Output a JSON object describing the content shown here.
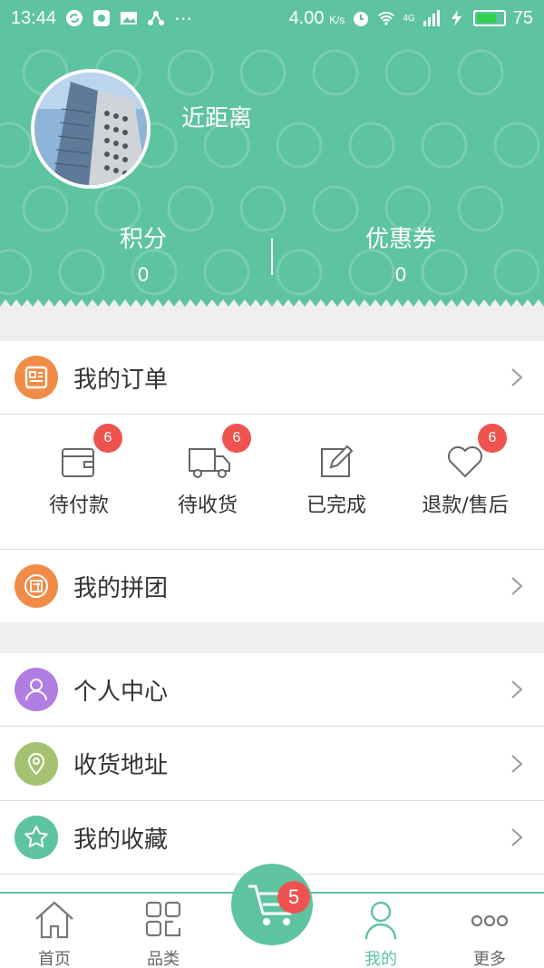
{
  "status_bar": {
    "time": "13:44",
    "speed": "4.00",
    "speed_unit": "K/s",
    "network": "4G",
    "battery": "75",
    "battery_level": 0.75,
    "battery_color": "#31d14d"
  },
  "profile": {
    "nickname": "近距离",
    "points_label": "积分",
    "points_value": "0",
    "coupons_label": "优惠券",
    "coupons_value": "0"
  },
  "menu": {
    "my_orders": "我的订单",
    "group_buy": "我的拼团",
    "personal_center": "个人中心",
    "address": "收货地址",
    "favorites": "我的收藏"
  },
  "orders": [
    {
      "label": "待付款",
      "badge": "6",
      "icon": "wallet-icon"
    },
    {
      "label": "待收货",
      "badge": "6",
      "icon": "truck-icon"
    },
    {
      "label": "已完成",
      "badge": "",
      "icon": "edit-note-icon"
    },
    {
      "label": "退款/售后",
      "badge": "6",
      "icon": "heart-icon"
    }
  ],
  "nav": {
    "home": "首页",
    "category": "品类",
    "cart_badge": "5",
    "mine": "我的",
    "more": "更多"
  },
  "colors": {
    "accent": "#5ec39f",
    "badge": "#ef5350",
    "orange": "#f08c47",
    "purple": "#b07de0",
    "olive": "#a4c271",
    "teal": "#5ec39f"
  }
}
